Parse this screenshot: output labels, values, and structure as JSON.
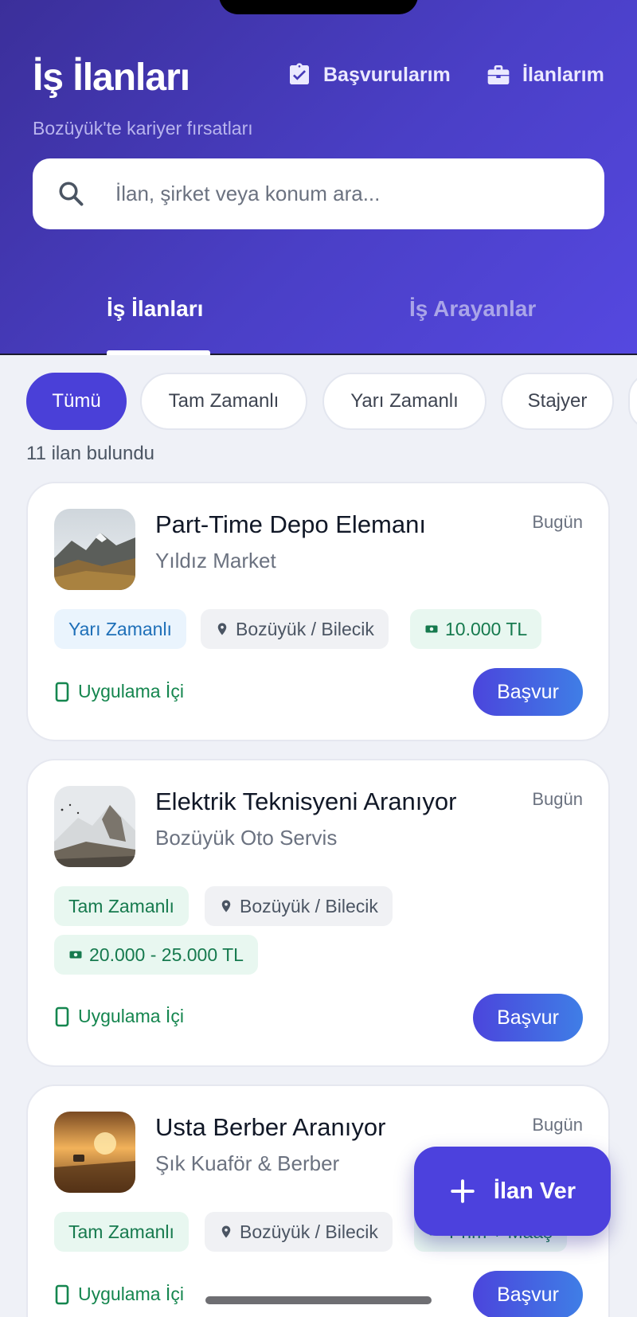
{
  "header": {
    "title": "İş İlanları",
    "subtitle": "Bozüyük'te kariyer fırsatları",
    "link_applications": "Başvurularım",
    "link_my_listings": "İlanlarım",
    "search_placeholder": "İlan, şirket veya konum ara...",
    "tabs": [
      {
        "label": "İş İlanları",
        "active": true
      },
      {
        "label": "İş Arayanlar",
        "active": false
      }
    ]
  },
  "filters": [
    "Tümü",
    "Tam Zamanlı",
    "Yarı Zamanlı",
    "Stajyer"
  ],
  "result_count": "11 ilan bulundu",
  "jobs": [
    {
      "title": "Part-Time Depo Elemanı",
      "company": "Yıldız Market",
      "date": "Bugün",
      "type": "Yarı Zamanlı",
      "location": "Bozüyük / Bilecik",
      "salary": "10.000 TL",
      "source": "Uygulama İçi",
      "apply": "Başvur"
    },
    {
      "title": "Elektrik Teknisyeni Aranıyor",
      "company": "Bozüyük Oto Servis",
      "date": "Bugün",
      "type": "Tam Zamanlı",
      "location": "Bozüyük / Bilecik",
      "salary": "20.000 - 25.000 TL",
      "source": "Uygulama İçi",
      "apply": "Başvur"
    },
    {
      "title": "Usta Berber Aranıyor",
      "company": "Şık Kuaför & Berber",
      "date": "Bugün",
      "type": "Tam Zamanlı",
      "location": "Bozüyük / Bilecik",
      "salary": "Prim + Maaş",
      "source": "Uygulama İçi",
      "apply": "Başvur"
    }
  ],
  "fab_label": "İlan Ver",
  "colors": {
    "primary": "#4a40d8",
    "header_start": "#3b2f9a",
    "header_end": "#5548e0",
    "success": "#15864f"
  }
}
